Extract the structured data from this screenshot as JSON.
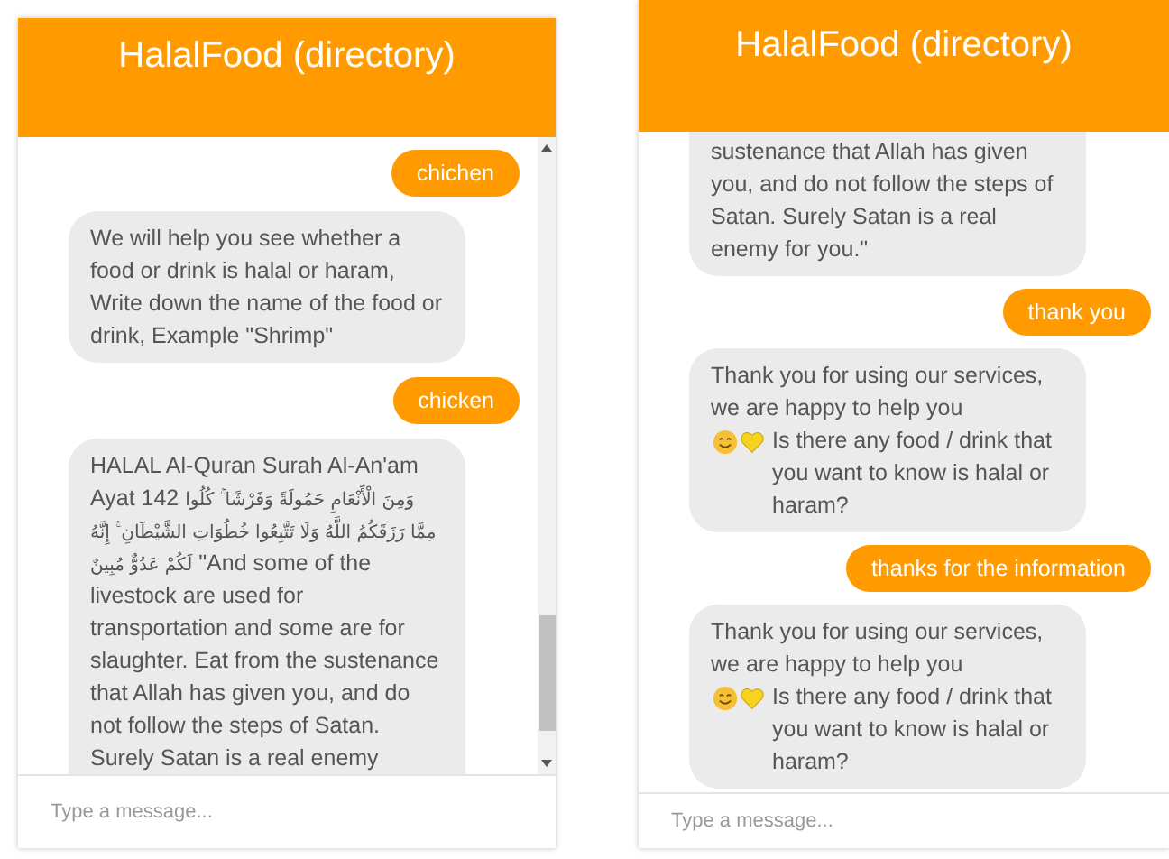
{
  "screens": [
    {
      "title": "HalalFood (directory)",
      "input": {
        "placeholder": "Type a message..."
      },
      "messages": [
        {
          "kind": "user",
          "text": "chichen"
        },
        {
          "kind": "bot",
          "text": "We will help you see whether a food or drink is halal or haram, Write down the name of the food or drink, Example \"Shrimp\""
        },
        {
          "kind": "user",
          "text": "chicken"
        },
        {
          "kind": "verse",
          "intro": "HALAL Al-Quran Surah Al-An'am Ayat 142",
          "arabic": "وَمِنَ الْأَنْعَامِ حَمُولَةً وَفَرْشًا ۚ كُلُوا مِمَّا رَزَقَكُمُ اللَّهُ وَلَا تَتَّبِعُوا خُطُوَاتِ الشَّيْطَانِ ۚ إِنَّهُ لَكُمْ عَدُوٌّ مُبِينٌ",
          "text": "\"And some of the livestock are used for transportation and some are for slaughter. Eat from the sustenance that Allah has given you, and do not follow the steps of Satan. Surely Satan is a real enemy"
        }
      ]
    },
    {
      "title": "HalalFood (directory)",
      "input": {
        "placeholder": "Type a message..."
      },
      "messages": [
        {
          "kind": "bot",
          "text": "sustenance that Allah has given you, and do not follow the steps of Satan. Surely Satan is a real enemy for you.\""
        },
        {
          "kind": "user",
          "text": "thank you"
        },
        {
          "kind": "bot-emoji",
          "text": "Thank you for using our services, we are happy to help you",
          "text_after": "Is there any food / drink that you want to know is halal or haram?"
        },
        {
          "kind": "user",
          "text": "thanks for the information"
        },
        {
          "kind": "bot-emoji",
          "text": "Thank you for using our services, we are happy to help you",
          "text_after": "Is there any food / drink that you want to know is halal or haram?"
        }
      ]
    }
  ]
}
